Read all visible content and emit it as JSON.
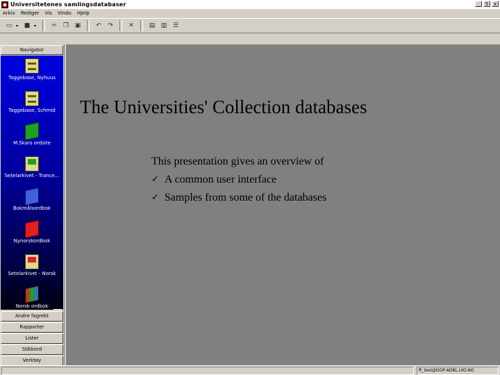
{
  "window": {
    "title": "Universitetenes samlingsdatabaser",
    "min_glyph": "_",
    "max_glyph": "5",
    "close_glyph": "x"
  },
  "menu": [
    "Arkiv",
    "Rediger",
    "Vis",
    "Vindu",
    "Hjelp"
  ],
  "navigator": {
    "header": "Navigator",
    "items": [
      {
        "label": "Taggebase, Nyhuus",
        "icon": "file-cabinet-icon"
      },
      {
        "label": "Taggebase, Schmid",
        "icon": "file-cabinet-icon"
      },
      {
        "label": "M.Skars ordsite",
        "icon": "green-book-icon"
      },
      {
        "label": "Setelarkivet - Trance...",
        "icon": "green-box-icon"
      },
      {
        "label": "Bokmålsordbok",
        "icon": "blue-book-icon"
      },
      {
        "label": "Nynorskordbok",
        "icon": "red-book-icon"
      },
      {
        "label": "Setelarkivet - Norsk",
        "icon": "red-box-icon"
      },
      {
        "label": "Norsk ordbok",
        "icon": "multicolor-book-icon"
      }
    ],
    "scroll_glyph": "▼",
    "buttons": [
      "Andre fagrekt",
      "Rapporter",
      "Lister",
      "Stikkord",
      "Verktøy"
    ]
  },
  "slide": {
    "title": "The Universities' Collection databases",
    "intro": "This presentation gives an overview of",
    "bullet_glyph": "ü",
    "bullets": [
      "A common user interface",
      "Samples from some of the databases"
    ]
  },
  "status": {
    "right": "ft_test@DOP-ADBL.UIO.NO"
  }
}
